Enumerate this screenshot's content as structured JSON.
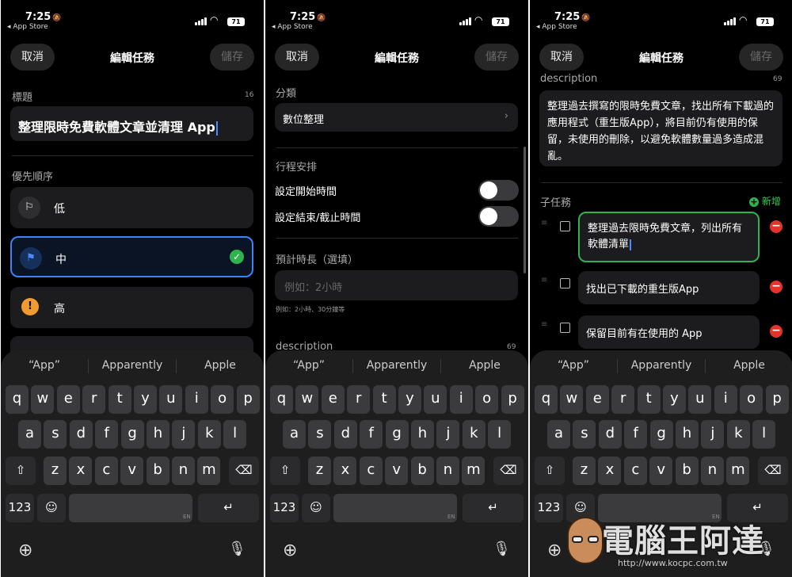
{
  "status": {
    "time": "7:25",
    "back": "◂ App Store",
    "battery": "71"
  },
  "header": {
    "cancel": "取消",
    "title": "編輯任務",
    "save": "儲存"
  },
  "screen1": {
    "title_label": "標題",
    "title_count": "16",
    "title_value": "整理限時免費軟體文章並清理 App",
    "priority_label": "優先順序",
    "priorities": [
      {
        "label": "低",
        "icon": "flag-outline-icon"
      },
      {
        "label": "中",
        "icon": "flag-filled-icon",
        "selected": true
      },
      {
        "label": "高",
        "icon": "exclamation-icon"
      }
    ]
  },
  "screen2": {
    "category_label": "分類",
    "category_value": "數位整理",
    "schedule_label": "行程安排",
    "start_label": "設定開始時間",
    "end_label": "設定結束/截止時間",
    "duration_label": "預計時長（選填）",
    "duration_placeholder": "例如：2小時",
    "duration_hint": "例如：2小時、30分鐘等",
    "desc_label": "description",
    "desc_count": "69"
  },
  "screen3": {
    "desc_label": "description",
    "desc_count": "69",
    "desc_value": "整理過去撰寫的限時免費文章，找出所有下載過的應用程式（重生版App），將目前仍有使用的保留，未使用的刪除，以避免軟體數量過多造成混亂。",
    "subtask_label": "子任務",
    "add_label": "新增",
    "subtasks": [
      "整理過去限時免費文章，列出所有軟體清單",
      "找出已下載的重生版App",
      "保留目前有在使用的 App"
    ]
  },
  "keyboard": {
    "suggestions": [
      "“App”",
      "Apparently",
      "Apple"
    ],
    "row1": [
      "q",
      "w",
      "e",
      "r",
      "t",
      "y",
      "u",
      "i",
      "o",
      "p"
    ],
    "row2": [
      "a",
      "s",
      "d",
      "f",
      "g",
      "h",
      "j",
      "k",
      "l"
    ],
    "row3": [
      "z",
      "x",
      "c",
      "v",
      "b",
      "n",
      "m"
    ],
    "num": "123",
    "lang": "EN"
  },
  "watermark": {
    "text": "電腦王阿達",
    "url": "http://www.kocpc.com.tw"
  }
}
